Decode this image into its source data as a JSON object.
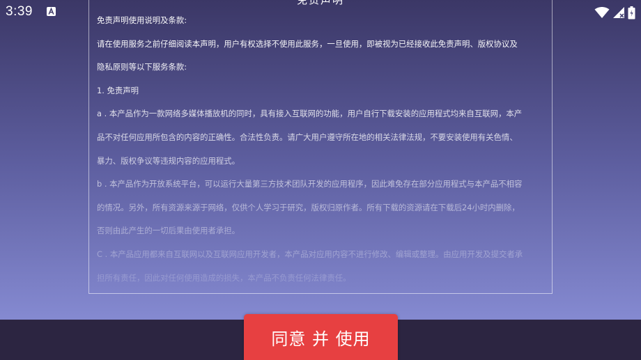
{
  "status_bar": {
    "time": "3:39",
    "app_icon": "a-square-icon",
    "icons": [
      "wifi-icon",
      "cell-signal-icon",
      "battery-icon"
    ]
  },
  "disclaimer": {
    "title": "免责声明",
    "lines": [
      "免责声明使用说明及条款:",
      "请在使用服务之前仔细阅读本声明，用户有权选择不使用此服务，一旦使用，即被视为已经接收此免责声明、版权协议及",
      "隐私原则等以下服务条款:",
      "1. 免责声明",
      "a . 本产品作为一款网络多媒体播放机的同时，具有接入互联网的功能，用户自行下载安装的应用程式均来自互联网，本产",
      "品不对任何应用所包含的内容的正确性。合法性负责。请广大用户遵守所在地的相关法律法规，不要安装使用有关色情、",
      "暴力、版权争议等违规内容的应用程式。",
      "b . 本产品作为开放系统平台，可以运行大量第三方技术团队开发的应用程序，因此难免存在部分应用程式与本产品不相容",
      "的情况。另外，所有资源来源于网络，仅供个人学习于研究，版权归原作者。所有下载的资源请在下载后24小时内删除，",
      "否则由此产生的一切后果由使用者承担。",
      "C . 本产品应用都来自互联网以及互联网应用开发者，本产品对应用内容不进行修改、编辑或整理。由应用开发及提交者承",
      "担所有责任，因此对任何使用造成的损失，本产品不负责任何法律责任。"
    ]
  },
  "agree_button": {
    "label": "同意 并 使用"
  },
  "colors": {
    "background_top": "#3b3766",
    "background_bottom": "#8f95de",
    "bottom_bar": "#2c2541",
    "accent_button": "#e74041"
  }
}
